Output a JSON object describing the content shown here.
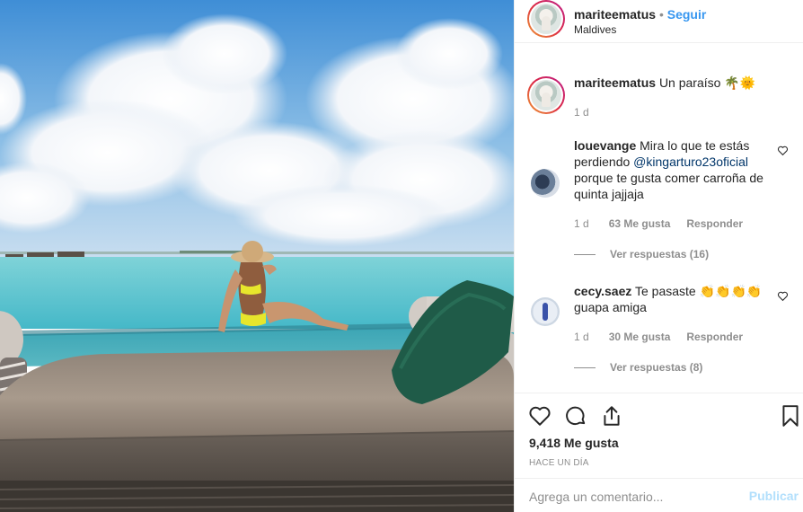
{
  "header": {
    "username": "mariteematus",
    "separator": "•",
    "follow_label": "Seguir",
    "location": "Maldives"
  },
  "caption": {
    "username": "mariteematus",
    "text": "Un paraíso",
    "emojis": "🌴🌞",
    "time": "1 d"
  },
  "comments": [
    {
      "username": "louevange",
      "text_before": "Mira lo que te estás perdiendo",
      "mention": "@kingarturo23oficial",
      "text_after": "porque te gusta comer carroña de quinta jajjaja",
      "time": "1 d",
      "likes": "63 Me gusta",
      "reply_label": "Responder",
      "view_replies": "Ver respuestas (16)"
    },
    {
      "username": "cecy.saez",
      "text": "Te pasaste",
      "emojis": "👏👏👏👏",
      "text_after": "guapa amiga",
      "time": "1 d",
      "likes": "30 Me gusta",
      "reply_label": "Responder",
      "view_replies": "Ver respuestas (8)"
    }
  ],
  "actions": {
    "likes": "9,418 Me gusta",
    "posted": "HACE UN DÍA"
  },
  "add_comment": {
    "placeholder": "Agrega un comentario...",
    "post_label": "Publicar"
  },
  "colors": {
    "accent": "#3897f0",
    "text": "#262626",
    "muted": "#8e8e8e",
    "border": "#efefef",
    "publish_disabled": "#b2dffc"
  },
  "icons": [
    "heart-icon",
    "comment-icon",
    "share-icon",
    "bookmark-icon"
  ]
}
